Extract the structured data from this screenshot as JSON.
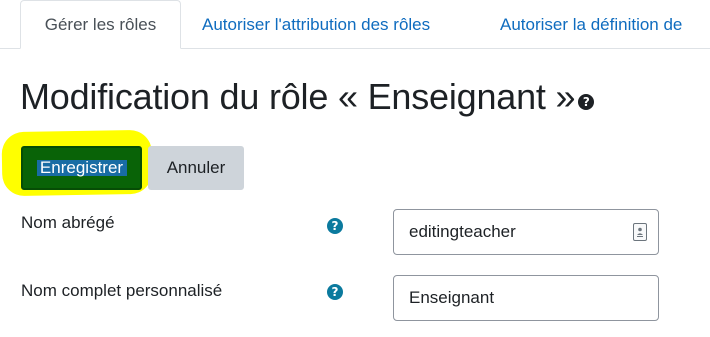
{
  "tabs": [
    {
      "label": "Gérer les rôles",
      "active": true
    },
    {
      "label": "Autoriser l'attribution des rôles",
      "active": false
    },
    {
      "label": "Autoriser la définition de",
      "active": false
    }
  ],
  "heading": {
    "title": "Modification du rôle « Enseignant »",
    "help_icon": "question-circle-icon"
  },
  "buttons": {
    "save_label": "Enregistrer",
    "cancel_label": "Annuler"
  },
  "form": {
    "short_name": {
      "label": "Nom abrégé",
      "value": "editingteacher",
      "help_icon": "question-circle-icon",
      "autofill_icon": "contact-card-icon"
    },
    "full_name": {
      "label": "Nom complet personnalisé",
      "value": "Enseignant",
      "help_icon": "question-circle-icon"
    }
  },
  "colors": {
    "link": "#0f6cbf",
    "primary_button": "#096307",
    "secondary_button": "#ced4da",
    "help_icon": "#0b7a9e",
    "highlight": "#ffff00"
  }
}
